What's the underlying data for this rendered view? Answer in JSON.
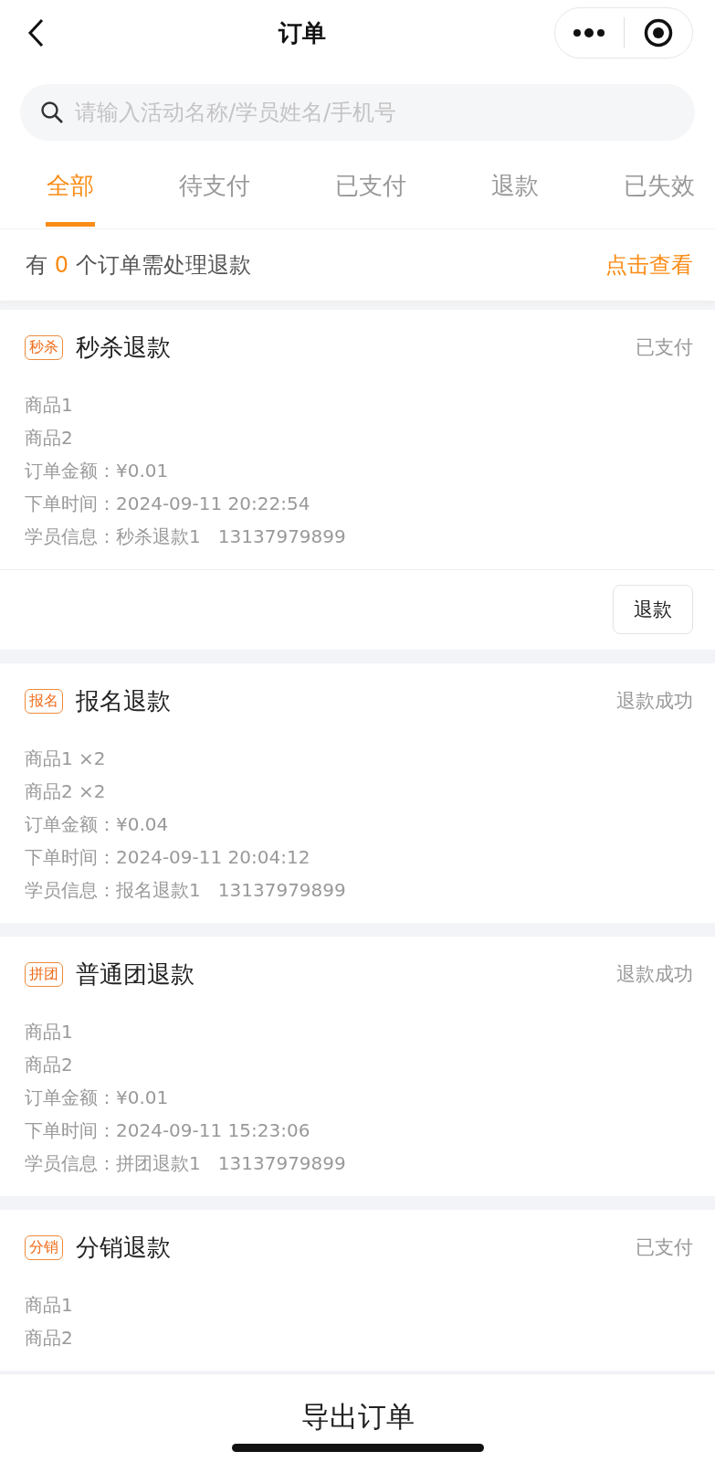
{
  "nav": {
    "title": "订单"
  },
  "search": {
    "placeholder": "请输入活动名称/学员姓名/手机号"
  },
  "tabs": [
    {
      "label": "全部",
      "selected": true
    },
    {
      "label": "待支付",
      "selected": false
    },
    {
      "label": "已支付",
      "selected": false
    },
    {
      "label": "退款",
      "selected": false
    },
    {
      "label": "已失效",
      "selected": false
    }
  ],
  "notice": {
    "prefix": "有",
    "count": "0",
    "suffix": "个订单需处理退款",
    "link": "点击查看"
  },
  "orders": [
    {
      "tag": "秒杀",
      "title": "秒杀退款",
      "status": "已支付",
      "lines": [
        "商品1",
        "商品2",
        "订单金额：¥0.01",
        "下单时间：2024-09-11 20:22:54",
        "学员信息：秒杀退款1   13137979899"
      ],
      "actions": [
        "退款"
      ]
    },
    {
      "tag": "报名",
      "title": "报名退款",
      "status": "退款成功",
      "lines": [
        "商品1 ×2",
        "商品2 ×2",
        "订单金额：¥0.04",
        "下单时间：2024-09-11 20:04:12",
        "学员信息：报名退款1   13137979899"
      ]
    },
    {
      "tag": "拼团",
      "title": "普通团退款",
      "status": "退款成功",
      "lines": [
        "商品1",
        "商品2",
        "订单金额：¥0.01",
        "下单时间：2024-09-11 15:23:06",
        "学员信息：拼团退款1   13137979899"
      ]
    },
    {
      "tag": "分销",
      "title": "分销退款",
      "status": "已支付",
      "lines": [
        "商品1",
        "商品2"
      ]
    }
  ],
  "footer": {
    "button": "导出订单"
  }
}
